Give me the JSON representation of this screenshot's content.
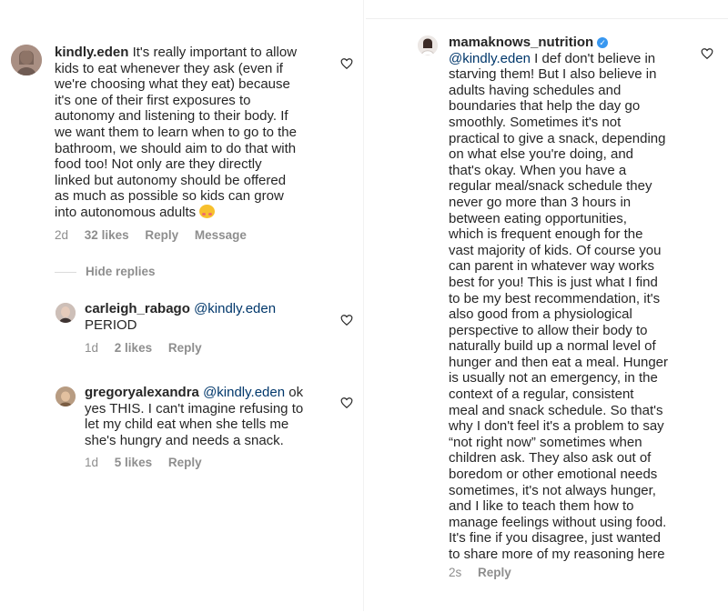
{
  "comments": {
    "kindly": {
      "username": "kindly.eden",
      "lines": [
        "It's really important to allow",
        "kids to eat whenever they ask (even if",
        "we're choosing what they eat) because",
        "it's one of their first exposures to",
        "autonomy and listening to their body. If",
        "we want them to learn when to go to the",
        "bathroom, we should aim to do that with",
        "food too! Not only are they directly",
        "linked but autonomy should be offered",
        "as much as possible so kids can grow",
        "into autonomous adults"
      ],
      "emoji": "smiling-face-with-hearts",
      "time": "2d",
      "likes": "32 likes",
      "reply": "Reply",
      "message": "Message"
    },
    "hide_replies": "Hide replies",
    "carleigh": {
      "username": "carleigh_rabago",
      "mention": "@kindly.eden",
      "text": "PERIOD",
      "time": "1d",
      "likes": "2 likes",
      "reply": "Reply"
    },
    "gregory": {
      "username": "gregoryalexandra",
      "mention": "@kindly.eden",
      "first": "ok",
      "lines": [
        "yes THIS. I can't imagine refusing to",
        "let my child eat when she tells me",
        "she's hungry and needs a snack."
      ],
      "time": "1d",
      "likes": "5 likes",
      "reply": "Reply"
    },
    "mama": {
      "username": "mamaknows_nutrition",
      "verified": true,
      "mention": "@kindly.eden",
      "first": "I def don't believe in",
      "lines": [
        "starving them! But I also believe in",
        "adults having schedules and",
        "boundaries that help the day go",
        "smoothly. Sometimes it's not",
        "practical to give a snack, depending",
        "on what else you're doing, and",
        "that's okay. When you have a",
        "regular meal/snack schedule they",
        "never go more than 3 hours in",
        "between eating opportunities,",
        "which is frequent enough for the",
        "vast majority of kids. Of course you",
        "can parent in whatever way works",
        "best for you! This is just what I find",
        "to be my best recommendation, it's",
        "also good from a physiological",
        "perspective to allow their body to",
        "naturally build up a normal level of",
        "hunger and then eat a meal. Hunger",
        "is usually not an emergency, in the",
        "context of a regular, consistent",
        "meal and snack schedule. So that's",
        "why I don't feel it's a problem to say",
        "“not right now” sometimes when",
        "children ask. They also ask out of",
        "boredom or other emotional needs",
        "sometimes, it's not always hunger,",
        "and I like to teach them how to",
        "manage feelings without using food.",
        "It's fine if you disagree, just wanted",
        "to share more of my reasoning here"
      ],
      "time": "2s",
      "reply": "Reply"
    }
  },
  "colors": {
    "text": "#262626",
    "meta": "#8e8e8e",
    "mention": "#00376b",
    "verified": "#3897f0"
  },
  "icons": {
    "like": "heart-outline-icon",
    "verified": "verified-badge-icon"
  }
}
